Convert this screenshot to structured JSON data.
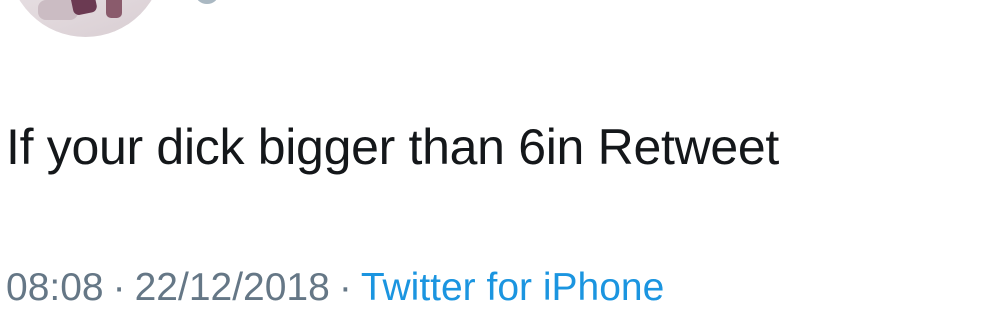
{
  "tweet": {
    "text": "If your dick bigger than 6in Retweet",
    "time": "08:08",
    "separator": "·",
    "date": "22/12/2018",
    "source": "Twitter for iPhone"
  },
  "colors": {
    "text": "#14171a",
    "meta": "#657786",
    "link": "#1b95e0"
  }
}
